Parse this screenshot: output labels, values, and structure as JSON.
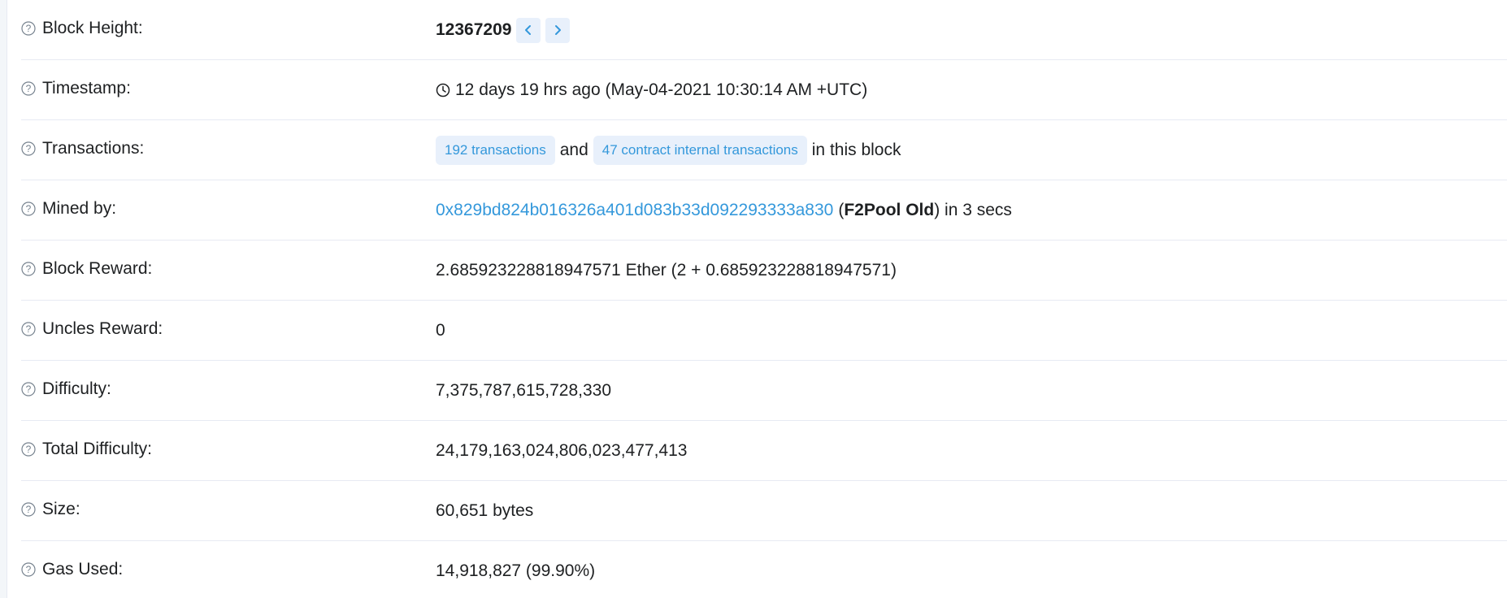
{
  "block_height": {
    "label": "Block Height:",
    "value": "12367209",
    "prev_icon": "chevron-left-icon",
    "next_icon": "chevron-right-icon"
  },
  "timestamp": {
    "label": "Timestamp:",
    "icon": "clock-icon",
    "value": "12 days 19 hrs ago (May-04-2021 10:30:14 AM +UTC)"
  },
  "transactions": {
    "label": "Transactions:",
    "tx_badge": "192 transactions",
    "and_text": "and",
    "internal_badge": "47 contract internal transactions",
    "suffix": "in this block"
  },
  "mined_by": {
    "label": "Mined by:",
    "address": "0x829bd824b016326a401d083b33d092293333a830",
    "open_paren": "(",
    "pool": "F2Pool Old",
    "suffix": ") in 3 secs"
  },
  "block_reward": {
    "label": "Block Reward:",
    "value": "2.685923228818947571 Ether (2 + 0.685923228818947571)"
  },
  "uncles_reward": {
    "label": "Uncles Reward:",
    "value": "0"
  },
  "difficulty": {
    "label": "Difficulty:",
    "value": "7,375,787,615,728,330"
  },
  "total_difficulty": {
    "label": "Total Difficulty:",
    "value": "24,179,163,024,806,023,477,413"
  },
  "size": {
    "label": "Size:",
    "value": "60,651 bytes"
  },
  "gas_used": {
    "label": "Gas Used:",
    "value": "14,918,827 (99.90%)"
  },
  "colors": {
    "link": "#3498db",
    "badge_bg": "#e8f0fb",
    "divider": "#e7eaf3",
    "text": "#1e2022",
    "icon_gray": "#77838f"
  }
}
